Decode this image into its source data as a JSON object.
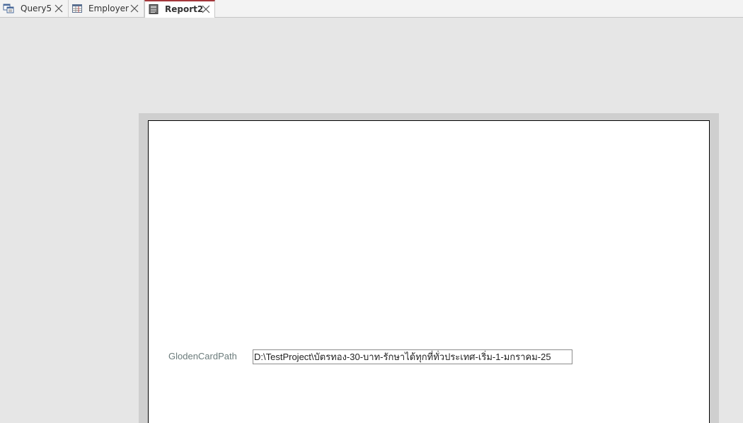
{
  "tabs": [
    {
      "label": "Query5",
      "icon": "query-icon",
      "active": false
    },
    {
      "label": "Employer",
      "icon": "table-icon",
      "active": false
    },
    {
      "label": "Report2",
      "icon": "report-icon",
      "active": true
    }
  ],
  "report": {
    "field_label": "GlodenCardPath",
    "field_value": "D:\\TestProject\\บัตรทอง-30-บาท-รักษาได้ทุกที่ทั่วประเทศ-เริ่ม-1-มกราคม-25"
  },
  "colors": {
    "active_tab_accent": "#a4373a",
    "workspace_background": "#e6e6e6",
    "label_text": "#6b7b7b"
  }
}
